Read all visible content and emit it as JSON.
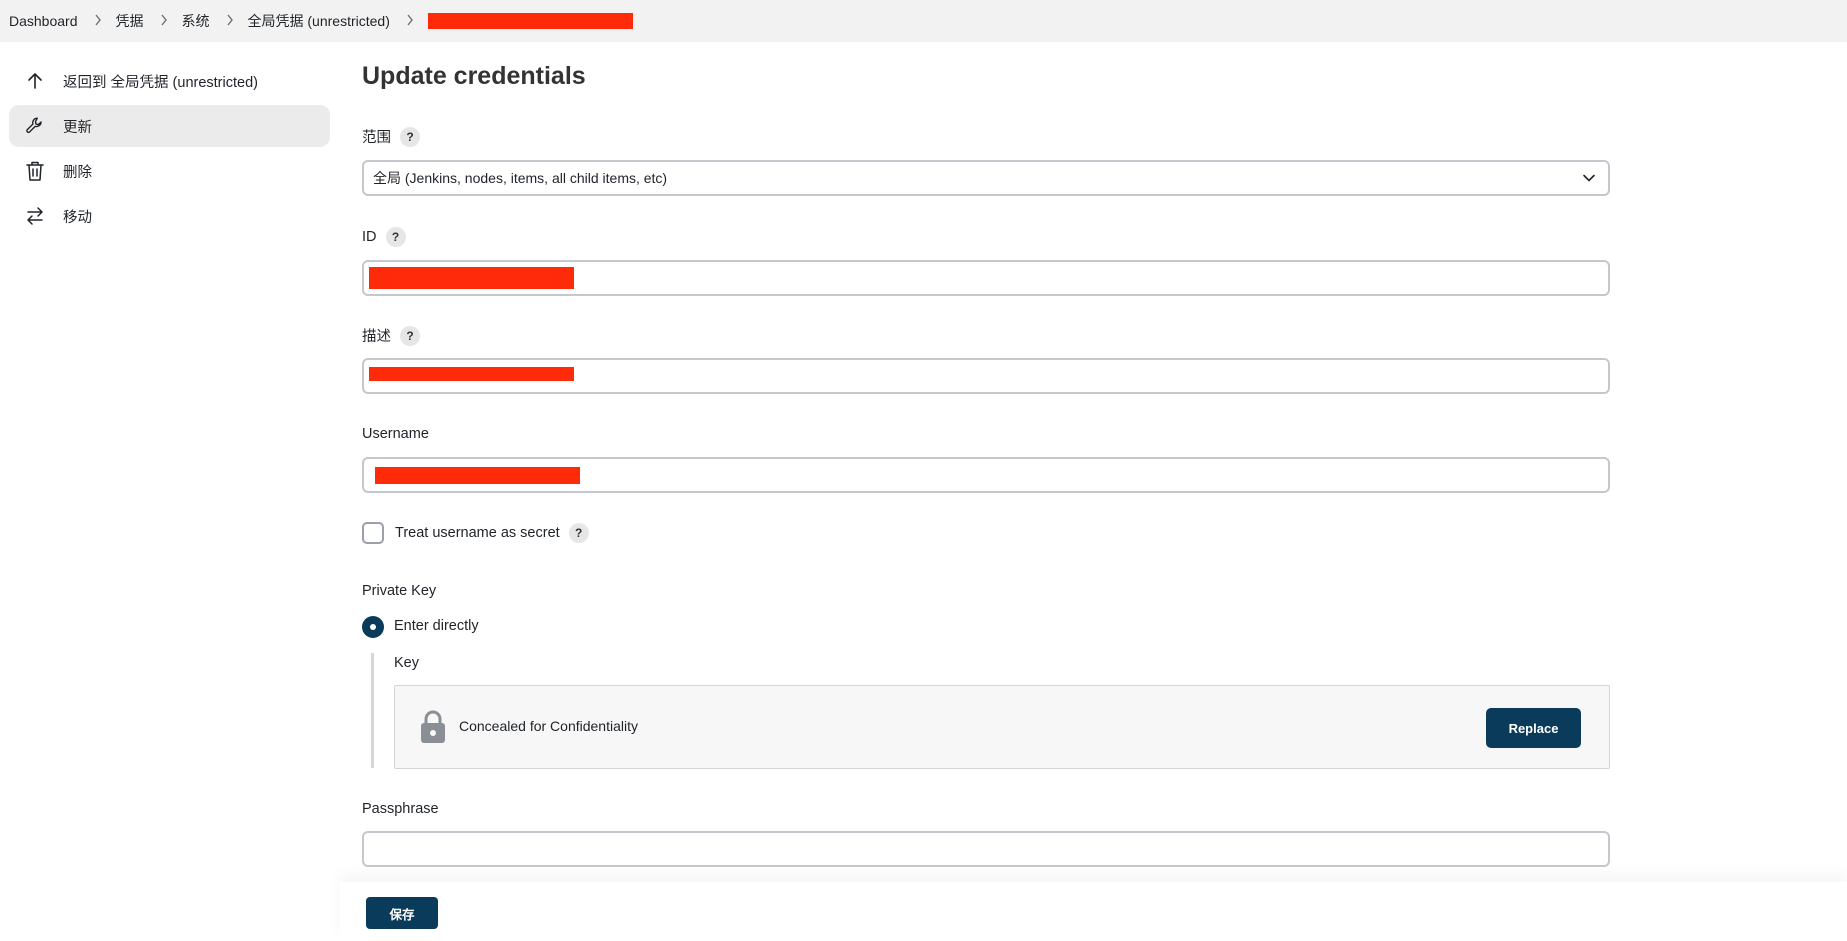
{
  "breadcrumb": {
    "items": [
      "Dashboard",
      "凭据",
      "系统",
      "全局凭据 (unrestricted)"
    ],
    "separator": ">"
  },
  "sidebar": {
    "items": [
      {
        "label": "返回到 全局凭据 (unrestricted)",
        "icon": "arrow-up-icon"
      },
      {
        "label": "更新",
        "icon": "wrench-icon",
        "active": true
      },
      {
        "label": "删除",
        "icon": "trash-icon"
      },
      {
        "label": "移动",
        "icon": "swap-arrows-icon"
      }
    ]
  },
  "form": {
    "title": "Update credentials",
    "scope": {
      "label": "范围",
      "value": "全局 (Jenkins, nodes, items, all child items, etc)"
    },
    "id": {
      "label": "ID"
    },
    "description": {
      "label": "描述"
    },
    "username": {
      "label": "Username"
    },
    "treat_secret": {
      "label": "Treat username as secret",
      "checked": false
    },
    "private_key": {
      "label": "Private Key",
      "option_label": "Enter directly",
      "key_label": "Key",
      "concealed_text": "Concealed for Confidentiality",
      "replace_label": "Replace"
    },
    "passphrase": {
      "label": "Passphrase",
      "value": ""
    },
    "help_glyph": "?"
  },
  "footer": {
    "save_label": "保存"
  },
  "colors": {
    "primary": "#0b3b5b",
    "redaction": "#ff2a0a",
    "breadcrumb_bg": "#f2f2f2",
    "active_bg": "#ebebeb"
  }
}
